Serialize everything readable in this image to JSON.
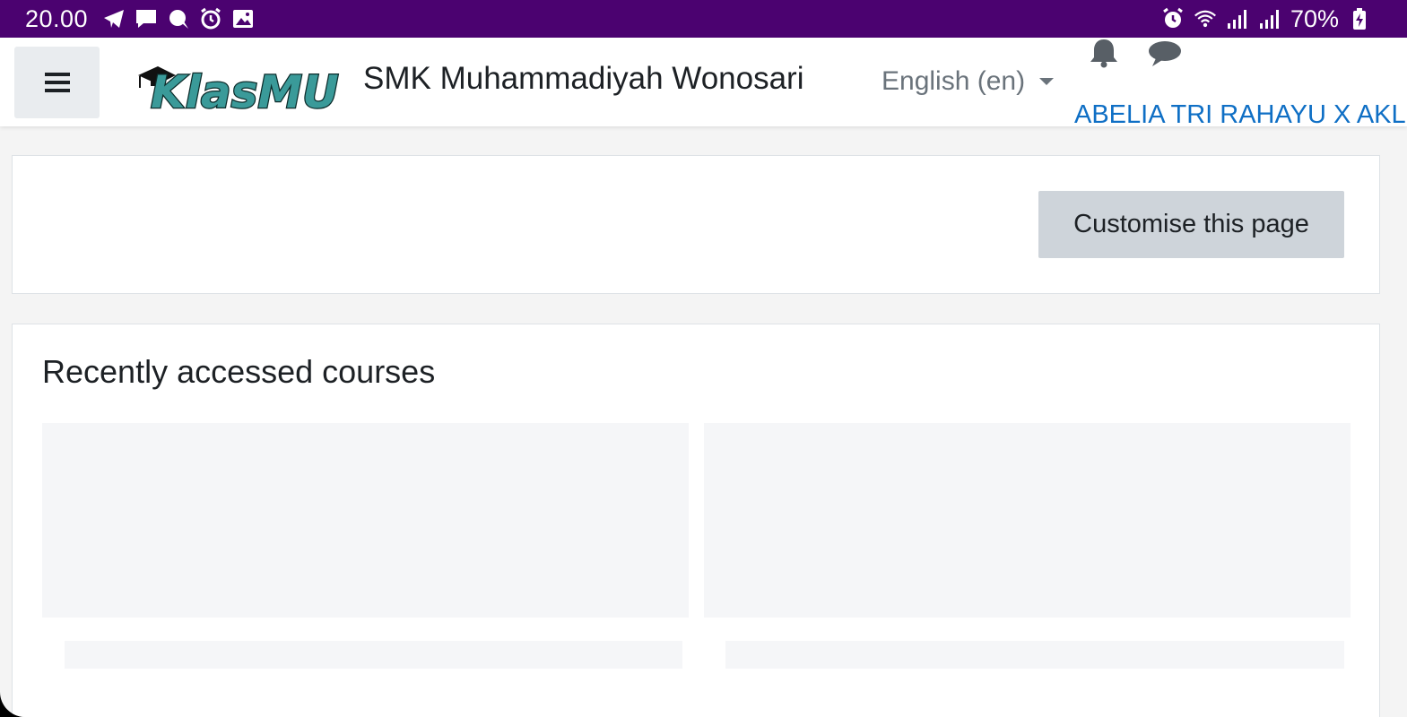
{
  "status_bar": {
    "time": "20.00",
    "battery": "70%",
    "left_icons": [
      "telegram-icon",
      "message-icon",
      "chat-bubble-icon",
      "alarm-icon",
      "gallery-icon"
    ],
    "right_icons": [
      "alarm-icon",
      "wifi-icon",
      "signal-icon",
      "signal-icon",
      "battery-charging-icon"
    ],
    "background_color": "#4b0270"
  },
  "navbar": {
    "site_name": "SMK Muhammadiyah Wonosari",
    "language": "English (en)",
    "username": "ABELIA TRI RAHAYU X AKL",
    "logo_text": "KlasMU",
    "link_color": "#0f6fc5"
  },
  "page": {
    "customise_button": "Customise this page",
    "recent_courses_title": "Recently accessed courses"
  }
}
